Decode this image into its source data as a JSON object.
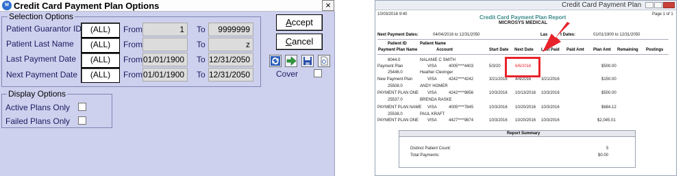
{
  "dialog": {
    "title": "Credit Card Payment Plan Options",
    "close": "×",
    "selection_options": {
      "legend": "Selection Options",
      "rows": [
        {
          "label": "Patient Guarantor ID",
          "select": "(ALL)",
          "from_label": "From",
          "from": "1",
          "to_label": "To",
          "to": "9999999"
        },
        {
          "label": "Patient Last Name",
          "select": "(ALL)",
          "from_label": "From",
          "from": "",
          "to_label": "To",
          "to": "z"
        },
        {
          "label": "Last Payment Date",
          "select": "(ALL)",
          "from_label": "From",
          "from": "01/01/1900",
          "to_label": "To",
          "to": "12/31/2050"
        },
        {
          "label": "Next Payment Date",
          "select": "(ALL)",
          "from_label": "From",
          "from": "01/01/1900",
          "to_label": "To",
          "to": "12/31/2050"
        }
      ]
    },
    "display_options": {
      "legend": "Display Options",
      "items": [
        "Active Plans Only",
        "Failed Plans Only"
      ]
    },
    "accept_key": "A",
    "accept_rest": "ccept",
    "cancel_key": "C",
    "cancel_rest": "ancel",
    "cover_label": "Cover"
  },
  "report": {
    "window_title": "Credit Card Payment Plan",
    "date": "10/03/2016 9:40",
    "page": "Page 1 of 1",
    "title": "Credit Card Payment Plan Report",
    "company": "MICROSYS MEDICAL",
    "next_dates_label": "Next Payment Dates:",
    "next_dates": "04/04/2016 to 12/31/2050",
    "last_dates_label": "Las",
    "last_dates_suffix": "t Dates:",
    "last_dates": "01/01/1900 to 12/31/2050",
    "headers": {
      "patient_id": "Patient ID",
      "patient_name": "Patient Name",
      "plan_name": "Payment Plan Name",
      "account": "Account",
      "start": "Start Date",
      "next": "Next Date",
      "last_paid": "Last Paid",
      "paid_amt": "Paid Amt",
      "plan_amt": "Plan Amt",
      "remaining": "Remaining",
      "postings": "Postings"
    },
    "rows": [
      {
        "id": "8044.0",
        "name": "NALANIE C SMITH",
        "plan": "Payment Plan",
        "card": "VISA",
        "account": "4005****4403",
        "start": "5/3/20",
        "next": "6/6/2016",
        "last": "",
        "plan_amt": "$500.00"
      },
      {
        "id": "25446.0",
        "name": "Heather Clevinger",
        "plan": "New Payment Plan",
        "card": "VISA",
        "account": "4242****4242",
        "start": "3/21/2016",
        "next": "4/4/2016",
        "last": "3/21/2016",
        "plan_amt": "$150.00"
      },
      {
        "id": "25508.0",
        "name": "ANDY HOMER",
        "plan": "PAYMENT PLAN ONE",
        "card": "VISA",
        "account": "4242****9856",
        "start": "10/3/2016",
        "next": "10/13/2016",
        "last": "10/3/2016",
        "plan_amt": "$500.00"
      },
      {
        "id": "25537.0",
        "name": "BRENDA RASKE",
        "plan": "PAYMENT PLAN NAME",
        "card": "VISA",
        "account": "4005****7845",
        "start": "10/3/2016",
        "next": "10/20/2016",
        "last": "10/3/2016",
        "plan_amt": "$684.12"
      },
      {
        "id": "25538.0",
        "name": "PAUL KRAFT",
        "plan": "PAYMENT PLAN ONE",
        "card": "VISA",
        "account": "4427****9874",
        "start": "10/3/2016",
        "next": "10/20/2016",
        "last": "10/3/2016",
        "plan_amt": "$2,045.01"
      }
    ],
    "summary": {
      "title": "Report Summary",
      "distinct_label": "Distinct Patient Count:",
      "distinct_value": "5",
      "total_label": "Total Payments:",
      "total_value": "$0.00"
    }
  },
  "colors": {
    "dialog_bg": "#cdd1ee",
    "report_title": "#3b8a8a",
    "highlight": "#e8222a"
  }
}
